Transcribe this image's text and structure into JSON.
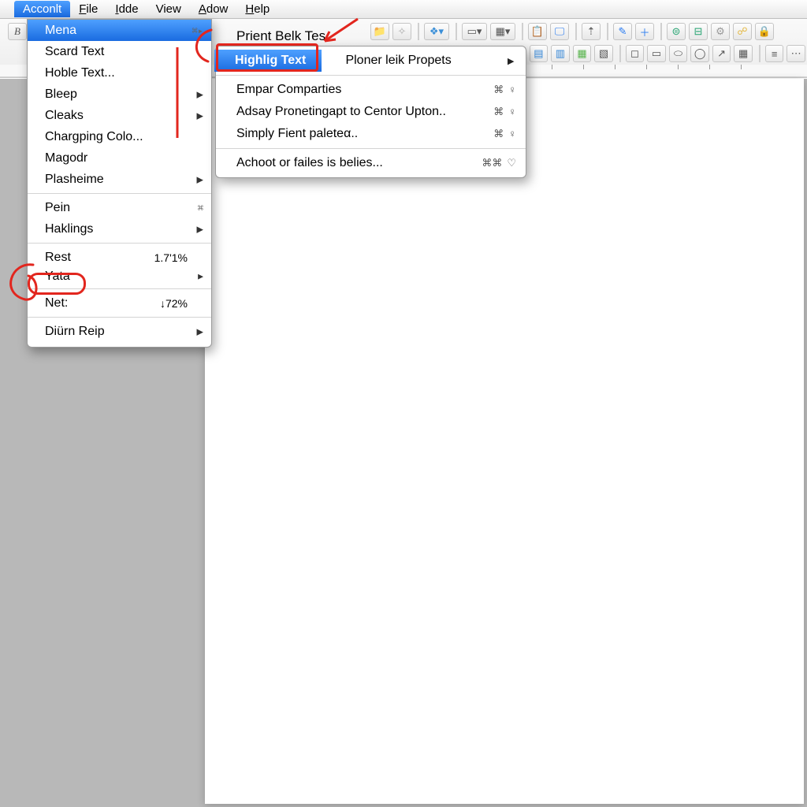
{
  "menubar": {
    "items": [
      "Acconlt",
      "File",
      "Idde",
      "View",
      "Adow",
      "Help"
    ],
    "active_index": 0
  },
  "dropdown": {
    "items": [
      {
        "label": "Mena",
        "active": true,
        "submenu": true,
        "glyph": "⌘▸"
      },
      {
        "label": "Scard Text"
      },
      {
        "label": "Hoble Text..."
      },
      {
        "label": "Bleep",
        "submenu": true
      },
      {
        "label": "Cleaks",
        "submenu": true
      },
      {
        "label": "Chargping Colo..."
      },
      {
        "label": "Magodr"
      },
      {
        "label": "Plasheime",
        "submenu": true
      },
      {
        "sep": true
      },
      {
        "label": "Pein",
        "glyph": "⌘"
      },
      {
        "label": "Haklings",
        "submenu": true
      },
      {
        "sep": true
      },
      {
        "label": "Rest",
        "value": "1.7'1%"
      },
      {
        "label": "Yata",
        "submenu": true
      },
      {
        "sep": true
      },
      {
        "label": "Net:",
        "value": "↓72%"
      },
      {
        "sep": true
      },
      {
        "label": "Diürn Reip",
        "submenu": true
      }
    ]
  },
  "header_label": "Prient Belk Tes",
  "submenu": {
    "items": [
      {
        "label": "Highlig Text",
        "highlight": true
      },
      {
        "label": "Ploner leik Propets",
        "submenu": true
      },
      {
        "sep": true
      },
      {
        "label": "Empar Comparties",
        "glyphs": [
          "⌘",
          "♀"
        ]
      },
      {
        "label": "Adsay Pronetingapt to Centor Upton..",
        "glyphs": [
          "⌘",
          "♀"
        ]
      },
      {
        "label": "Simply Fient paleteα..",
        "glyphs": [
          "⌘",
          "♀"
        ]
      },
      {
        "sep": true
      },
      {
        "label": "Achoot or failes is belies...",
        "glyphs": [
          "⌘⌘",
          "♡"
        ]
      }
    ]
  },
  "toolbar": {
    "row1": [
      "B",
      "new",
      "open",
      "save",
      "spacer",
      "print",
      "preview",
      "spacer",
      "cube",
      "spacer",
      "page",
      "table",
      "spacer",
      "paste",
      "view",
      "spacer",
      "text",
      "spacer",
      "edit",
      "plus",
      "spacer",
      "db",
      "db2",
      "gear",
      "link",
      "lock"
    ],
    "row2": [
      "t1",
      "t2",
      "t3",
      "t4",
      "color",
      "photo",
      "chart",
      "calc",
      "spacer",
      "box1",
      "box2",
      "box3",
      "box4",
      "arrow",
      "grid",
      "spacer",
      "align",
      "ruler"
    ]
  },
  "colors": {
    "accent": "#2a7bf0",
    "annotation": "#e2261e"
  }
}
